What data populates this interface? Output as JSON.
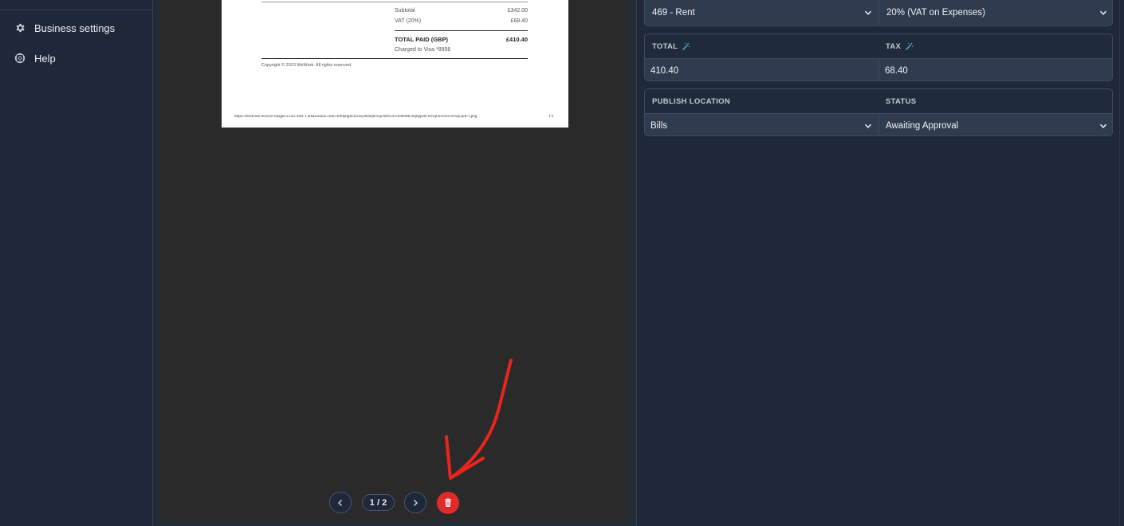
{
  "sidebar": {
    "items": [
      {
        "label": "Business settings",
        "icon": "gear-icon"
      },
      {
        "label": "Help",
        "icon": "lifebuoy-icon"
      }
    ]
  },
  "document": {
    "subtotal_label": "Subtotal",
    "subtotal_value": "£342.00",
    "vat_label": "VAT (20%)",
    "vat_value": "£68.40",
    "total_label": "TOTAL PAID (GBP)",
    "total_value": "£410.40",
    "charged_to": "Charged to Visa *8956",
    "copyright": "Copyright © 2023 WeWork. All rights reserved.",
    "url": "https://briefcase-invoice-images.s3.eu-west-1.amazonaws.com/cmf0pngfn3oxssy0hb8jm1ojcmtff545v0496ftb10q0jqz0z-eNZp/invoice-eNZp.pdf-1.png",
    "page_num": "1/1"
  },
  "pager": {
    "count": "1 / 2"
  },
  "fields": {
    "account": "469 - Rent",
    "tax_rate": "20% (VAT on Expenses)",
    "total_label": "TOTAL",
    "tax_label": "TAX",
    "total_value": "410.40",
    "tax_value": "68.40",
    "publish_label": "PUBLISH LOCATION",
    "status_label": "STATUS",
    "publish_value": "Bills",
    "status_value": "Awaiting Approval"
  },
  "colors": {
    "accent_delete": "#e02b2b",
    "annotation": "#e8251e",
    "wand_icon": "#4fb3c8"
  }
}
